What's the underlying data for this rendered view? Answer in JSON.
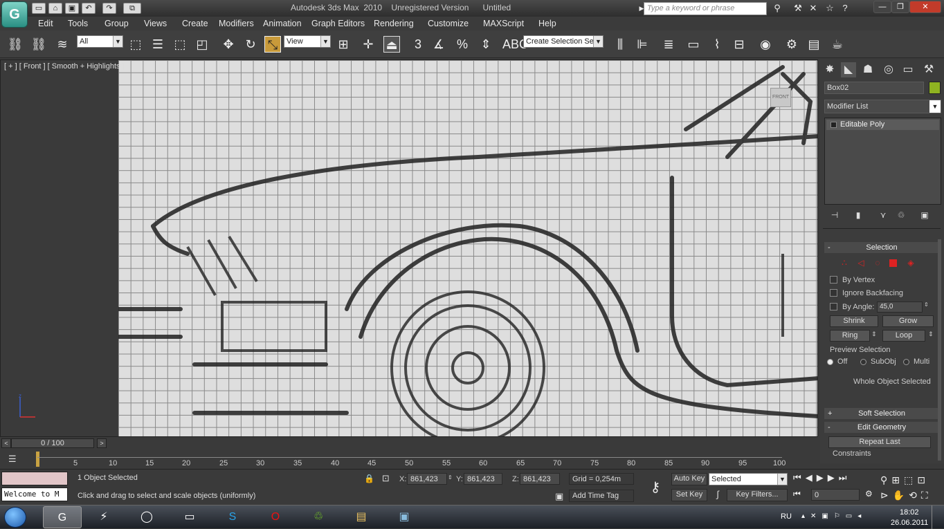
{
  "titlebar": {
    "title": "Autodesk 3ds Max  2010    Unregistered Version      Untitled",
    "search_placeholder": "Type a keyword or phrase"
  },
  "menu": [
    "Edit",
    "Tools",
    "Group",
    "Views",
    "Create",
    "Modifiers",
    "Animation",
    "Graph Editors",
    "Rendering",
    "Customize",
    "MAXScript",
    "Help"
  ],
  "toolbar": {
    "selection_filter": "All",
    "reference_coord": "View",
    "named_selection": "Create Selection Se"
  },
  "viewport": {
    "label": "[ + ] [ Front ] [ Smooth + Highlights ]",
    "navcube_label": "FRONT"
  },
  "command_panel": {
    "object_name": "Box02",
    "object_color": "#8fb321",
    "modifier_list": "Modifier List",
    "stack_item": "Editable Poly",
    "selection": {
      "header": "Selection",
      "by_vertex": "By Vertex",
      "ignore_backfacing": "Ignore Backfacing",
      "by_angle": "By Angle:",
      "angle_value": "45,0",
      "shrink": "Shrink",
      "grow": "Grow",
      "ring": "Ring",
      "loop": "Loop",
      "preview_selection": "Preview Selection",
      "off": "Off",
      "subobj": "SubObj",
      "multi": "Multi",
      "whole_object": "Whole Object Selected"
    },
    "soft_selection": "Soft Selection",
    "edit_geometry": "Edit Geometry",
    "repeat_last": "Repeat Last",
    "constraints": "Constraints"
  },
  "timeslider": {
    "position": "0 / 100"
  },
  "trackbar_ticks": [
    "5",
    "10",
    "15",
    "20",
    "25",
    "30",
    "35",
    "40",
    "45",
    "50",
    "55",
    "60",
    "65",
    "70",
    "75",
    "80",
    "85",
    "90",
    "95",
    "100"
  ],
  "status": {
    "maxscript_listener": "Welcome to M",
    "objects_selected": "1 Object Selected",
    "prompt": "Click and drag to select and scale objects (uniformly)",
    "x_label": "X:",
    "x_value": "861,423",
    "y_label": "Y:",
    "y_value": "861,423",
    "z_label": "Z:",
    "z_value": "861,423",
    "grid": "Grid = 0,254m",
    "add_time_tag": "Add Time Tag",
    "auto_key": "Auto Key",
    "set_key": "Set Key",
    "key_mode": "Selected",
    "key_filters": "Key Filters...",
    "frame": "0"
  },
  "taskbar": {
    "language": "RU",
    "time": "18:02",
    "date": "26.06.2011"
  }
}
